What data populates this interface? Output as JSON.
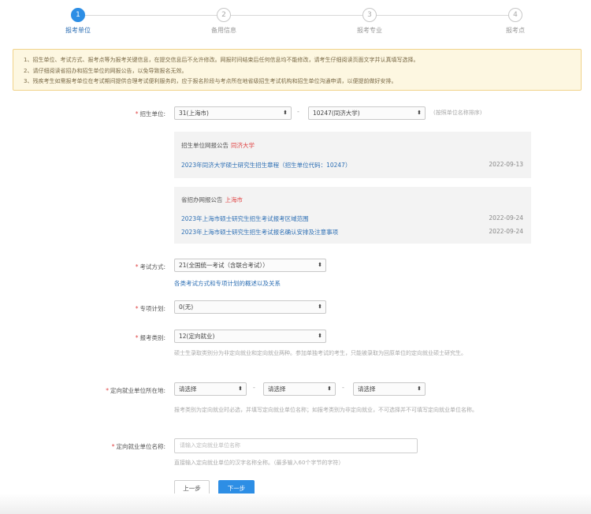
{
  "stepper": {
    "steps": [
      {
        "number": "1",
        "label": "报考单位",
        "active": true
      },
      {
        "number": "2",
        "label": "备用信息",
        "active": false
      },
      {
        "number": "3",
        "label": "报考专业",
        "active": false
      },
      {
        "number": "4",
        "label": "报考点",
        "active": false
      }
    ]
  },
  "notice": {
    "lines": [
      "1、招生单位、考试方式、报考点等为报考关键信息，在提交信息后不允许修改。网报时间结束后任何信息均不能修改，请考生仔细阅读页面文字并认真填写选择。",
      "2、请仔细阅读省招办和招生单位的网报公告，以免导致报名无效。",
      "3、残疾考生如需报考单位在考试期间提供合理考试便利服务的，应于报名阶段与考点所在地省级招生考试机构和招生单位沟通申请，以便提前做好安排。"
    ]
  },
  "form": {
    "unit": {
      "label": "招生单位:",
      "province_value": "31(上海市)",
      "school_value": "10247(同济大学)",
      "hint": "(按照单位名称排序)"
    },
    "unit_announcement": {
      "title": "招生单位网报公告",
      "title_highlight": "同济大学",
      "items": [
        {
          "text": "2023年同济大学硕士研究生招生章程（招生单位代码：10247）",
          "date": "2022-09-13"
        }
      ]
    },
    "province_announcement": {
      "title": "省招办网报公告",
      "title_highlight": "上海市",
      "items": [
        {
          "text": "2023年上海市硕士研究生招生考试报考区域范围",
          "date": "2022-09-24"
        },
        {
          "text": "2023年上海市硕士研究生招生考试报名确认安排及注意事项",
          "date": "2022-09-24"
        }
      ]
    },
    "exam_method": {
      "label": "考试方式:",
      "value": "21(全国统一考试（含联合考试））",
      "link": "各类考试方式和专项计划的概述以及关系"
    },
    "special_plan": {
      "label": "专项计划:",
      "value": "0(无)"
    },
    "category": {
      "label": "报考类别:",
      "value": "12(定向就业)",
      "hint": "硕士生录取类别分为非定向就业和定向就业两种。参加单独考试的考生，只能被录取为回原单位的定向就业硕士研究生。"
    },
    "directed_location": {
      "label": "定向就业单位所在地:",
      "select1": "请选择",
      "select2": "请选择",
      "select3": "请选择",
      "dash": "-",
      "hint": "报考类别为定向就业时必选，并填写定向就业单位名称；如报考类别为非定向就业，不可选择并不可填写定向就业单位名称。"
    },
    "directed_unit": {
      "label": "定向就业单位名称:",
      "placeholder": "请输入定向就业单位名称",
      "hint": "直接输入定向就业单位的汉字名称全称。（最多输入60个字节的字符）"
    }
  },
  "buttons": {
    "prev": "上一步",
    "next": "下一步"
  },
  "colors": {
    "primary": "#2d8ee5",
    "link": "#2d6fb4",
    "required": "#e04646",
    "notice_bg": "#fdf7e1",
    "notice_border": "#f1d38a"
  }
}
